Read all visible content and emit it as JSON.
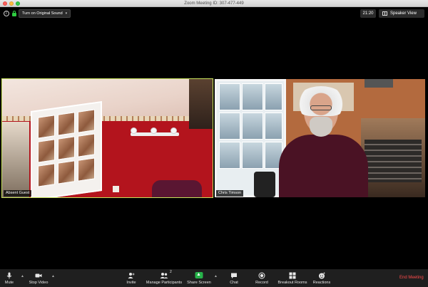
{
  "window": {
    "title": "Zoom Meeting ID: 307-477-449"
  },
  "top_bar": {
    "original_sound_label": "Turn on Original Sound",
    "time": "21:20",
    "speaker_view_label": "Speaker View"
  },
  "participants": [
    {
      "name": "Absent Guest"
    },
    {
      "name": "Chris Timson"
    }
  ],
  "toolbar": {
    "mute_label": "Mute",
    "stop_video_label": "Stop Video",
    "invite_label": "Invite",
    "manage_participants_label": "Manage Participants",
    "participant_count": "2",
    "share_screen_label": "Share Screen",
    "chat_label": "Chat",
    "record_label": "Record",
    "breakout_rooms_label": "Breakout Rooms",
    "reactions_label": "Reactions",
    "end_meeting_label": "End Meeting"
  },
  "colors": {
    "active_speaker_border": "#c5e05a",
    "end_meeting": "#ff4b4b",
    "share_screen": "#27b24a"
  }
}
